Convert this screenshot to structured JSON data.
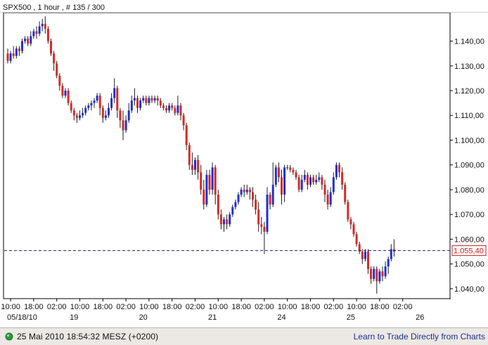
{
  "header": {
    "title": "SPX500 , 1 hour , # 135 / 300"
  },
  "footer": {
    "datetime": "25 Mai 2010  18:54:32  MESZ (+0200)",
    "link_text": "Learn to Trade Directly from Charts"
  },
  "colors": {
    "up": "#1f2fd6",
    "down": "#d62a25",
    "wick": "#202020",
    "price_line": "#1a1a8c",
    "price_box": "#c32020"
  },
  "chart_data": {
    "type": "candlestick",
    "title": "SPX500 , 1 hour , # 135 / 300",
    "ylim": [
      1036.0,
      1151.5
    ],
    "y_ticks": [
      "1.040,00",
      "1.050,00",
      "1.060,00",
      "1.070,00",
      "1.080,00",
      "1.090,00",
      "1.100,00",
      "1.110,00",
      "1.120,00",
      "1.130,00",
      "1.140,00"
    ],
    "y_tick_values": [
      1040,
      1050,
      1060,
      1070,
      1080,
      1090,
      1100,
      1110,
      1120,
      1130,
      1140
    ],
    "x_ticks": [
      "10:00",
      "18:00",
      "02:00",
      "10:00",
      "18:00",
      "02:00",
      "10:00",
      "18:00",
      "02:00",
      "10:00",
      "18:00",
      "02:00",
      "10:00",
      "18:00",
      "02:00",
      "10:00",
      "18:00",
      "02:00"
    ],
    "date_labels": [
      {
        "label": "05/18/10",
        "index": 1
      },
      {
        "label": "19",
        "index": 23
      },
      {
        "label": "20",
        "index": 47
      },
      {
        "label": "21",
        "index": 71
      },
      {
        "label": "24",
        "index": 95
      },
      {
        "label": "25",
        "index": 119
      },
      {
        "label": "26",
        "index": 143
      }
    ],
    "current_price": 1055.4,
    "current_price_label": "1.055,40",
    "grid": false,
    "candles": [
      [
        1135,
        1132,
        1137,
        1131
      ],
      [
        1132,
        1135,
        1136,
        1131
      ],
      [
        1135,
        1134,
        1138,
        1133
      ],
      [
        1134,
        1137,
        1138,
        1133
      ],
      [
        1137,
        1136,
        1138,
        1134
      ],
      [
        1136,
        1140,
        1141,
        1135
      ],
      [
        1140,
        1141,
        1142,
        1139
      ],
      [
        1141,
        1139,
        1142,
        1138
      ],
      [
        1139,
        1142,
        1144,
        1138
      ],
      [
        1142,
        1144,
        1145,
        1141
      ],
      [
        1144,
        1143,
        1146,
        1141
      ],
      [
        1143,
        1146,
        1148,
        1142
      ],
      [
        1146,
        1147,
        1149,
        1144
      ],
      [
        1147,
        1145,
        1150,
        1143
      ],
      [
        1145,
        1140,
        1146,
        1139
      ],
      [
        1140,
        1135,
        1141,
        1134
      ],
      [
        1135,
        1131,
        1136,
        1128
      ],
      [
        1131,
        1126,
        1132,
        1125
      ],
      [
        1126,
        1122,
        1127,
        1120
      ],
      [
        1122,
        1118,
        1123,
        1117
      ],
      [
        1118,
        1120,
        1121,
        1117
      ],
      [
        1120,
        1115,
        1121,
        1114
      ],
      [
        1115,
        1112,
        1116,
        1111
      ],
      [
        1112,
        1110,
        1113,
        1108
      ],
      [
        1110,
        1109,
        1111,
        1107
      ],
      [
        1109,
        1110,
        1112,
        1108
      ],
      [
        1110,
        1111,
        1113,
        1109
      ],
      [
        1111,
        1113,
        1114,
        1110
      ],
      [
        1113,
        1114,
        1115,
        1112
      ],
      [
        1114,
        1115,
        1116,
        1112
      ],
      [
        1115,
        1116,
        1117,
        1113
      ],
      [
        1116,
        1118,
        1119,
        1115
      ],
      [
        1118,
        1113,
        1119,
        1110
      ],
      [
        1113,
        1109,
        1114,
        1107
      ],
      [
        1109,
        1110,
        1112,
        1108
      ],
      [
        1110,
        1113,
        1115,
        1109
      ],
      [
        1113,
        1117,
        1119,
        1112
      ],
      [
        1117,
        1121,
        1125,
        1115
      ],
      [
        1121,
        1112,
        1122,
        1109
      ],
      [
        1112,
        1108,
        1113,
        1105
      ],
      [
        1108,
        1104,
        1112,
        1100
      ],
      [
        1104,
        1108,
        1110,
        1103
      ],
      [
        1108,
        1112,
        1115,
        1107
      ],
      [
        1112,
        1116,
        1118,
        1111
      ],
      [
        1116,
        1117,
        1121,
        1114
      ],
      [
        1117,
        1113,
        1118,
        1111
      ],
      [
        1113,
        1116,
        1117,
        1112
      ],
      [
        1116,
        1117,
        1118,
        1115
      ],
      [
        1117,
        1115,
        1118,
        1114
      ],
      [
        1115,
        1117,
        1118,
        1114
      ],
      [
        1117,
        1116,
        1118,
        1115
      ],
      [
        1116,
        1117,
        1118,
        1115
      ],
      [
        1117,
        1116,
        1118,
        1114
      ],
      [
        1116,
        1114,
        1117,
        1113
      ],
      [
        1114,
        1113,
        1115,
        1112
      ],
      [
        1113,
        1112,
        1114,
        1111
      ],
      [
        1112,
        1114,
        1115,
        1111
      ],
      [
        1114,
        1113,
        1115,
        1112
      ],
      [
        1113,
        1111,
        1114,
        1110
      ],
      [
        1111,
        1114,
        1118,
        1110
      ],
      [
        1114,
        1110,
        1115,
        1108
      ],
      [
        1110,
        1106,
        1111,
        1104
      ],
      [
        1106,
        1098,
        1107,
        1096
      ],
      [
        1098,
        1090,
        1099,
        1088
      ],
      [
        1090,
        1088,
        1095,
        1086
      ],
      [
        1088,
        1092,
        1093,
        1086
      ],
      [
        1092,
        1087,
        1094,
        1084
      ],
      [
        1087,
        1080,
        1090,
        1078
      ],
      [
        1080,
        1074,
        1084,
        1072
      ],
      [
        1074,
        1086,
        1088,
        1073
      ],
      [
        1086,
        1080,
        1088,
        1078
      ],
      [
        1080,
        1089,
        1091,
        1078
      ],
      [
        1089,
        1078,
        1090,
        1074
      ],
      [
        1078,
        1070,
        1080,
        1068
      ],
      [
        1070,
        1066,
        1072,
        1064
      ],
      [
        1066,
        1068,
        1069,
        1063
      ],
      [
        1068,
        1066,
        1070,
        1064
      ],
      [
        1066,
        1070,
        1071,
        1065
      ],
      [
        1070,
        1073,
        1074,
        1069
      ],
      [
        1073,
        1075,
        1076,
        1072
      ],
      [
        1075,
        1078,
        1079,
        1074
      ],
      [
        1078,
        1080,
        1081,
        1077
      ],
      [
        1080,
        1079,
        1082,
        1077
      ],
      [
        1079,
        1080,
        1082,
        1078
      ],
      [
        1080,
        1079,
        1081,
        1076
      ],
      [
        1079,
        1076,
        1081,
        1073
      ],
      [
        1076,
        1072,
        1078,
        1070
      ],
      [
        1072,
        1066,
        1075,
        1063
      ],
      [
        1066,
        1065,
        1069,
        1062
      ],
      [
        1065,
        1063,
        1067,
        1054
      ],
      [
        1063,
        1078,
        1081,
        1062
      ],
      [
        1078,
        1074,
        1079,
        1072
      ],
      [
        1074,
        1082,
        1091,
        1073
      ],
      [
        1082,
        1089,
        1090,
        1081
      ],
      [
        1089,
        1085,
        1091,
        1083
      ],
      [
        1085,
        1078,
        1088,
        1074
      ],
      [
        1078,
        1089,
        1090,
        1075
      ],
      [
        1089,
        1089,
        1090,
        1088
      ],
      [
        1089,
        1088,
        1090,
        1087
      ],
      [
        1088,
        1087,
        1089,
        1086
      ],
      [
        1087,
        1085,
        1088,
        1084
      ],
      [
        1085,
        1080,
        1086,
        1079
      ],
      [
        1080,
        1084,
        1086,
        1079
      ],
      [
        1084,
        1086,
        1088,
        1083
      ],
      [
        1086,
        1082,
        1087,
        1080
      ],
      [
        1082,
        1085,
        1086,
        1081
      ],
      [
        1085,
        1083,
        1086,
        1082
      ],
      [
        1083,
        1084,
        1086,
        1082
      ],
      [
        1084,
        1085,
        1087,
        1083
      ],
      [
        1085,
        1082,
        1086,
        1080
      ],
      [
        1082,
        1078,
        1084,
        1075
      ],
      [
        1078,
        1074,
        1080,
        1072
      ],
      [
        1074,
        1079,
        1081,
        1073
      ],
      [
        1079,
        1085,
        1087,
        1078
      ],
      [
        1085,
        1090,
        1091,
        1084
      ],
      [
        1090,
        1087,
        1091,
        1085
      ],
      [
        1087,
        1082,
        1089,
        1080
      ],
      [
        1082,
        1075,
        1083,
        1074
      ],
      [
        1075,
        1068,
        1076,
        1067
      ],
      [
        1068,
        1066,
        1069,
        1064
      ],
      [
        1066,
        1062,
        1067,
        1061
      ],
      [
        1062,
        1058,
        1063,
        1057
      ],
      [
        1058,
        1055,
        1059,
        1054
      ],
      [
        1055,
        1052,
        1056,
        1050
      ],
      [
        1052,
        1055,
        1056,
        1051
      ],
      [
        1055,
        1048,
        1056,
        1046
      ],
      [
        1048,
        1044,
        1049,
        1042
      ],
      [
        1044,
        1048,
        1049,
        1043
      ],
      [
        1048,
        1043,
        1049,
        1038
      ],
      [
        1043,
        1047,
        1048,
        1042
      ],
      [
        1047,
        1045,
        1049,
        1043
      ],
      [
        1045,
        1049,
        1051,
        1044
      ],
      [
        1049,
        1052,
        1053,
        1046
      ],
      [
        1052,
        1056,
        1058,
        1051
      ],
      [
        1056,
        1055,
        1060,
        1053
      ]
    ]
  }
}
